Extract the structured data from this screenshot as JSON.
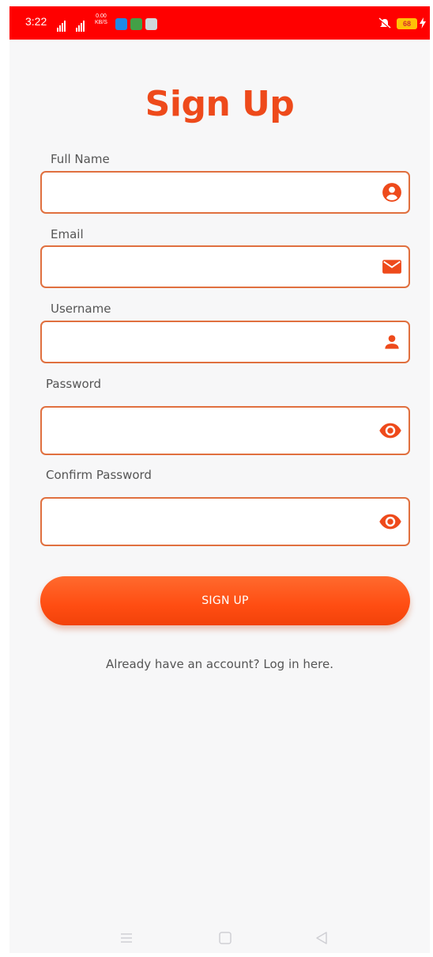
{
  "status_bar": {
    "time": "3:22",
    "speed_value": "0.00",
    "speed_unit": "KB/S",
    "battery": "68",
    "bar_color": "#ff0000"
  },
  "title": "Sign Up",
  "fields": [
    {
      "label": "Full Name",
      "value": "",
      "placeholder": "",
      "icon": "account-circle-icon"
    },
    {
      "label": "Email",
      "value": "",
      "placeholder": "",
      "icon": "email-icon"
    },
    {
      "label": "Username",
      "value": "",
      "placeholder": "",
      "icon": "person-icon"
    },
    {
      "label": "Password",
      "value": "",
      "placeholder": "",
      "icon": "eye-icon"
    },
    {
      "label": "Confirm Password",
      "value": "",
      "placeholder": "",
      "icon": "eye-icon"
    }
  ],
  "signup_button": "SIGN UP",
  "login_link": "Already have an account? Log in here.",
  "nav_bar": {
    "buttons": [
      "menu-icon",
      "home-square-icon",
      "back-triangle-icon"
    ]
  },
  "colors": {
    "accent": "#ee4a1b",
    "field_border": "#e0703f",
    "button": "#ff5216",
    "background": "#f7f7f8"
  }
}
